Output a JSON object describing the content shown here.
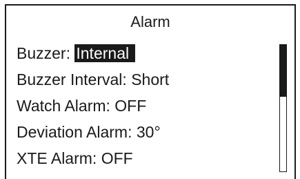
{
  "screen": {
    "title": "Alarm"
  },
  "menu": {
    "items": [
      {
        "label": "Buzzer: ",
        "value": "Internal",
        "selected": true
      },
      {
        "label": "Buzzer Interval: ",
        "value": "Short",
        "selected": false
      },
      {
        "label": "Watch Alarm: ",
        "value": "OFF",
        "selected": false
      },
      {
        "label": "Deviation Alarm: ",
        "value": "30°",
        "selected": false
      },
      {
        "label": "XTE Alarm: ",
        "value": "OFF",
        "selected": false
      }
    ]
  },
  "scrollbar": {
    "visible_fraction": 0.4
  },
  "colors": {
    "foreground": "#1a1a1a",
    "background": "#ffffff",
    "highlight_text": "#ffffff"
  }
}
